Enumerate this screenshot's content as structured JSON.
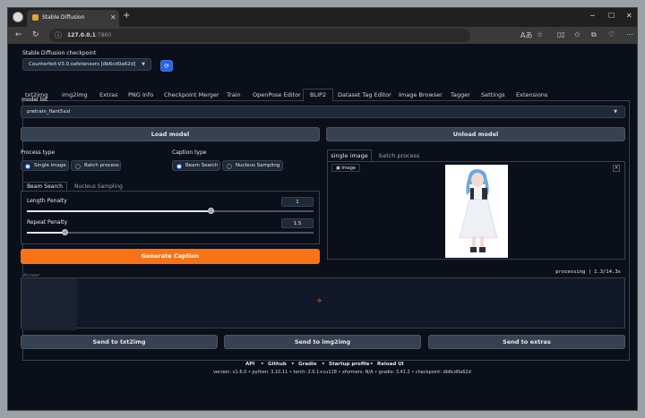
{
  "browser": {
    "tab_title": "Stable Diffusion",
    "url_host": "127.0.0.1",
    "url_port": ":7860"
  },
  "checkpoint": {
    "label": "Stable Diffusion checkpoint",
    "value": "Counterfeit-V3.0.safetensors [db6cd0a62d]"
  },
  "tabs": [
    "txt2img",
    "img2img",
    "Extras",
    "PNG Info",
    "Checkpoint Merger",
    "Train",
    "OpenPose Editor",
    "BLIP2",
    "Dataset Tag Editor",
    "Image Browser",
    "Tagger",
    "Settings",
    "Extensions"
  ],
  "model_list": {
    "label": "model list",
    "value": "pretrain_flant5xxl"
  },
  "buttons": {
    "load": "Load model",
    "unload": "Unload model",
    "generate": "Generate Caption",
    "send_txt2img": "Send to txt2img",
    "send_img2img": "Send to img2img",
    "send_extras": "Send to extras"
  },
  "process_type": {
    "label": "Process type",
    "options": [
      "Single image",
      "Batch process"
    ],
    "selected": "Single image"
  },
  "caption_type": {
    "label": "Caption type",
    "options": [
      "Beam Search",
      "Nucleus Sampling"
    ],
    "selected": "Beam Search"
  },
  "sampling_tabs": [
    "Beam Search",
    "Nucleus Sampling"
  ],
  "sliders": {
    "length": {
      "label": "Length Penalty",
      "value": "1",
      "fraction": 0.64
    },
    "repeat": {
      "label": "Repeat Penalty",
      "value": "1.5",
      "fraction": 0.13
    }
  },
  "image_tabs": [
    "single image",
    "batch process"
  ],
  "image_label": "Image",
  "answer": {
    "label": "Answer",
    "status": "processing | 1.3/14.3s"
  },
  "footer": {
    "links": [
      "API",
      "Github",
      "Gradio",
      "Startup profile",
      "Reload UI"
    ],
    "version": "version: v1.6.0  •  python: 3.10.11  •  torch: 2.0.1+cu118  •  xformers: N/A  •  gradio: 3.41.2  •  checkpoint: db6cd0a62d"
  },
  "colors": {
    "accent_orange": "#f97316",
    "accent_blue": "#2563eb",
    "background": "#0b0f19"
  }
}
